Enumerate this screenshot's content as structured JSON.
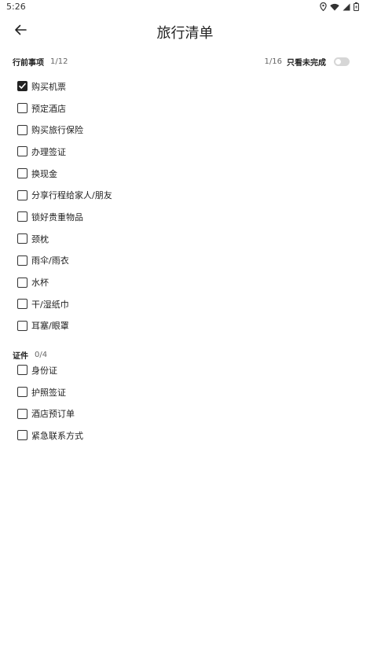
{
  "status": {
    "time": "5:26"
  },
  "header": {
    "title": "旅行清单"
  },
  "filter": {
    "count": "1/16",
    "label": "只看未完成",
    "enabled": false
  },
  "sections": [
    {
      "title": "行前事项",
      "count": "1/12",
      "items": [
        {
          "label": "购买机票",
          "checked": true
        },
        {
          "label": "预定酒店",
          "checked": false
        },
        {
          "label": "购买旅行保险",
          "checked": false
        },
        {
          "label": "办理签证",
          "checked": false
        },
        {
          "label": "换现金",
          "checked": false
        },
        {
          "label": "分享行程给家人/朋友",
          "checked": false
        },
        {
          "label": "锁好贵重物品",
          "checked": false
        },
        {
          "label": "颈枕",
          "checked": false
        },
        {
          "label": "雨伞/雨衣",
          "checked": false
        },
        {
          "label": "水杯",
          "checked": false
        },
        {
          "label": "干/湿纸巾",
          "checked": false
        },
        {
          "label": "耳塞/眼罩",
          "checked": false
        }
      ]
    },
    {
      "title": "证件",
      "count": "0/4",
      "items": [
        {
          "label": "身份证",
          "checked": false
        },
        {
          "label": "护照签证",
          "checked": false
        },
        {
          "label": "酒店预订单",
          "checked": false
        },
        {
          "label": "紧急联系方式",
          "checked": false
        }
      ]
    }
  ]
}
